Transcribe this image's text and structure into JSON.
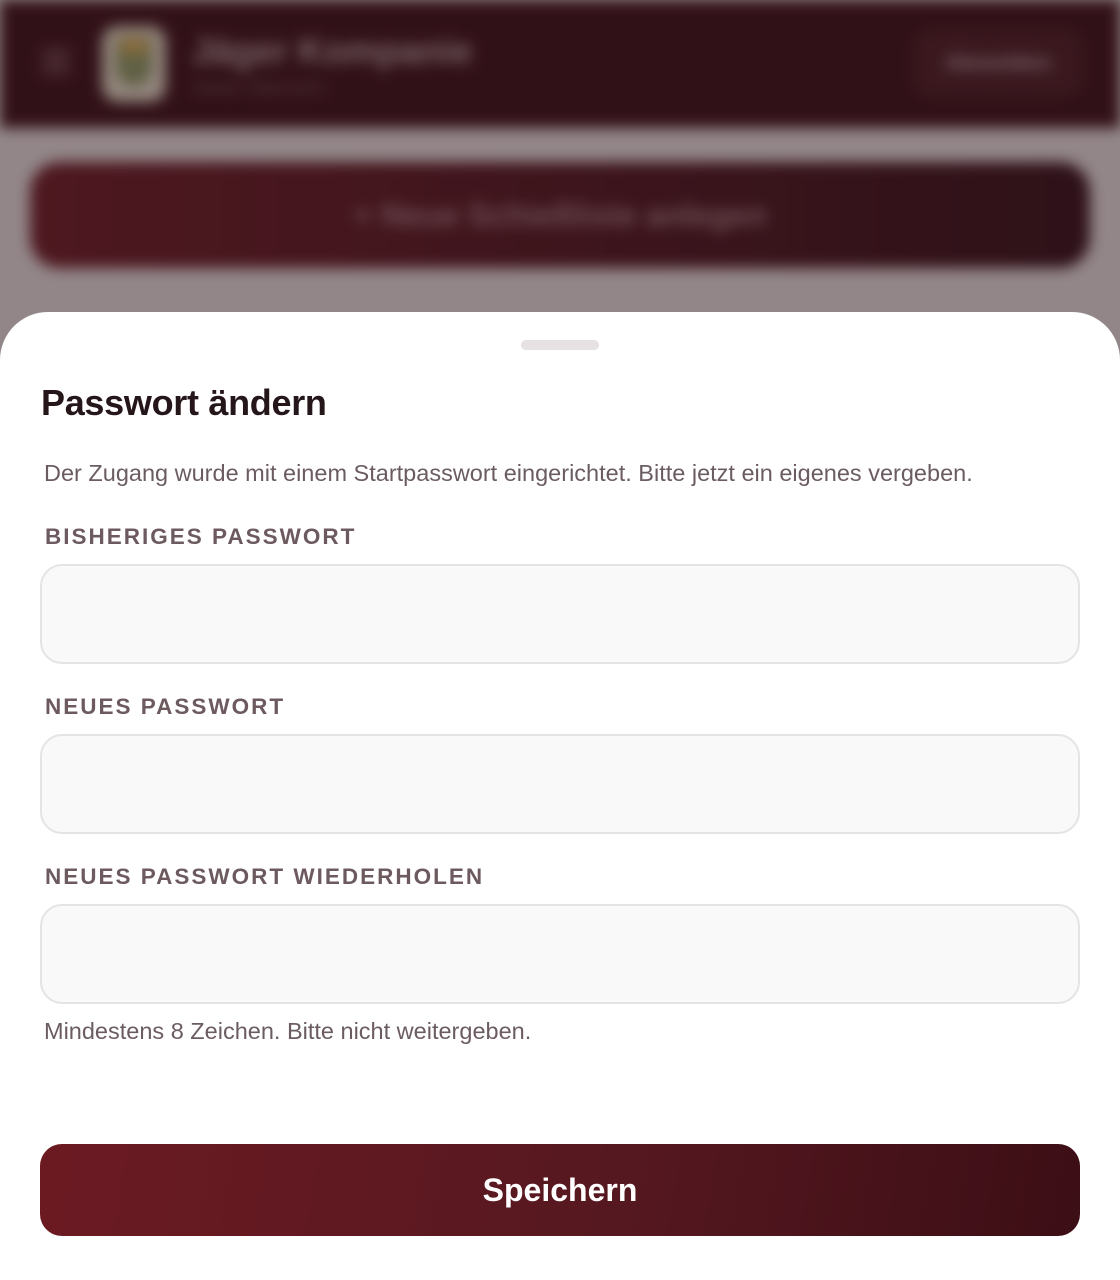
{
  "background": {
    "header": {
      "club_name": "Jäger Kompanie",
      "club_subtitle": "Verein Übersicht",
      "logout_label": "Abmelden"
    },
    "new_list_button": "+ Neue Schießliste anlegen"
  },
  "sheet": {
    "title": "Passwort ändern",
    "description": "Der Zugang wurde mit einem Startpasswort eingerichtet. Bitte jetzt ein eigenes vergeben.",
    "fields": [
      {
        "label": "BISHERIGES PASSWORT",
        "value": "",
        "placeholder": ""
      },
      {
        "label": "NEUES PASSWORT",
        "value": "",
        "placeholder": ""
      },
      {
        "label": "NEUES PASSWORT WIEDERHOLEN",
        "value": "",
        "placeholder": ""
      }
    ],
    "hint": "Mindestens 8 Zeichen. Bitte nicht weitergeben.",
    "save_label": "Speichern"
  },
  "colors": {
    "brand_dark": "#3a1018",
    "button_gradient_start": "#6c1a22",
    "button_gradient_end": "#3c0e15",
    "title_text": "#25161a",
    "muted_text": "#6b5c60",
    "input_background": "#f9f9f9",
    "input_border": "#e6e3e4"
  },
  "icons": {
    "menu": "hamburger-menu-icon",
    "logo": "club-crest-logo"
  }
}
